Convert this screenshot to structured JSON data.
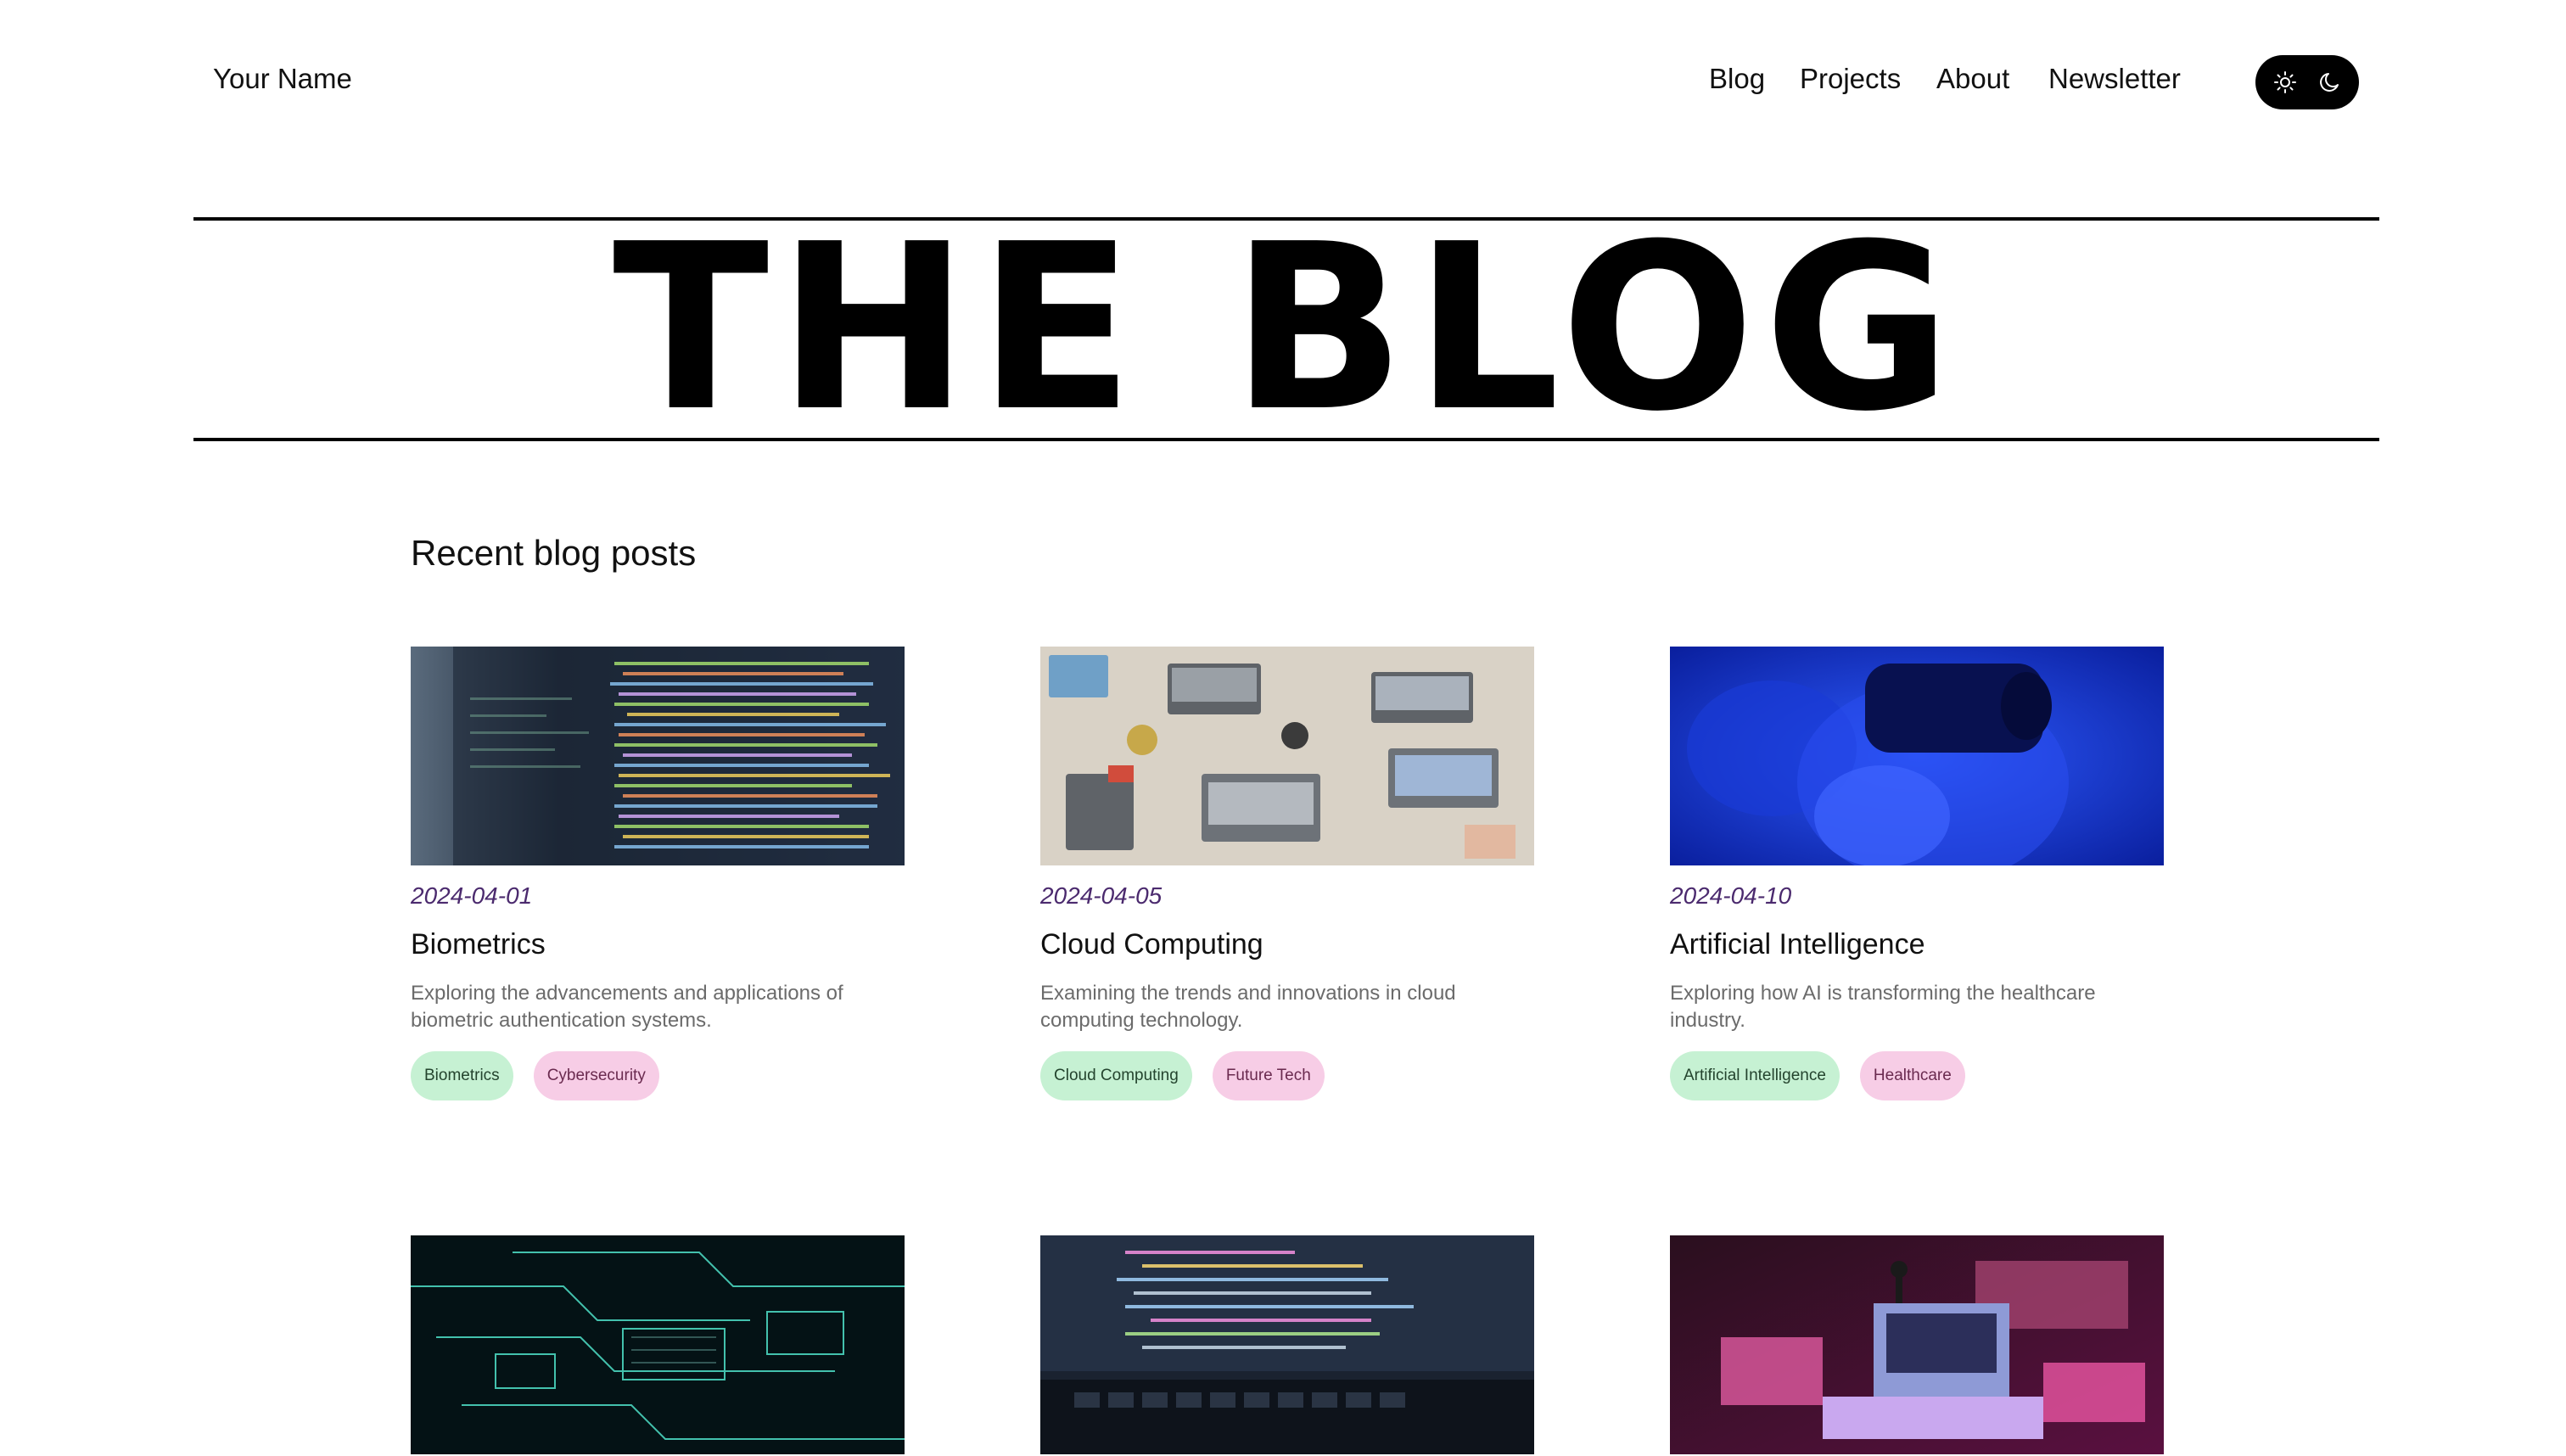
{
  "header": {
    "brand": "Your Name",
    "nav": [
      "Blog",
      "Projects",
      "About",
      "Newsletter"
    ],
    "theme_toggle": {
      "icons": [
        "sun-icon",
        "moon-icon"
      ],
      "background": "#000000"
    }
  },
  "hero": {
    "title": "THE BLOG"
  },
  "section": {
    "title": "Recent blog posts"
  },
  "posts": [
    {
      "image": "code-screen",
      "date": "2024-04-01",
      "title": "Biometrics",
      "description": "Exploring the advancements and applications of biometric authentication systems.",
      "tags": [
        "Biometrics",
        "Cybersecurity"
      ]
    },
    {
      "image": "team-laptops-table",
      "date": "2024-04-05",
      "title": "Cloud Computing",
      "description": "Examining the trends and innovations in cloud computing technology.",
      "tags": [
        "Cloud Computing",
        "Future Tech"
      ]
    },
    {
      "image": "vr-headset-blue",
      "date": "2024-04-10",
      "title": "Artificial Intelligence",
      "description": "Exploring how AI is transforming the healthcare industry.",
      "tags": [
        "Artificial Intelligence",
        "Healthcare"
      ]
    },
    {
      "image": "circuit-board-glow"
    },
    {
      "image": "laptop-code-dark"
    },
    {
      "image": "retro-computers-neon"
    }
  ],
  "colors": {
    "date": "#4b2a6e",
    "tag_green_bg": "#c6f1d3",
    "tag_pink_bg": "#f7cde6",
    "description": "#6b6b6b"
  }
}
